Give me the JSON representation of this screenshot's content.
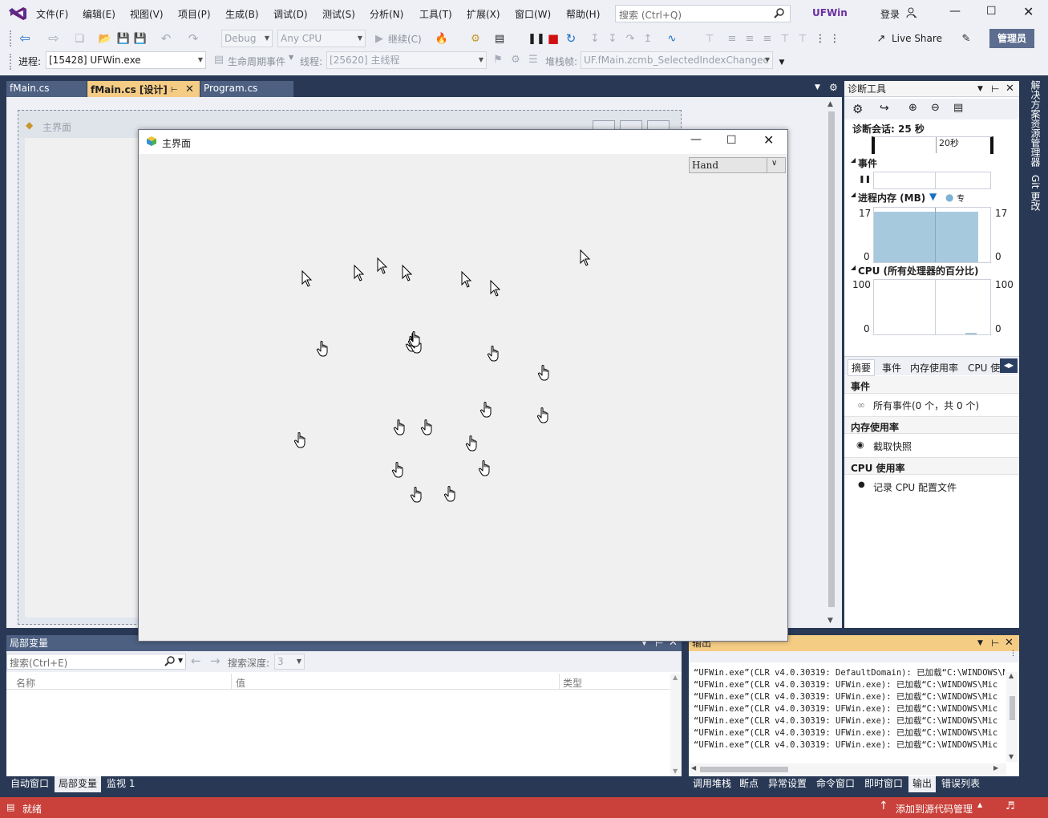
{
  "menu": {
    "items": [
      "文件(F)",
      "编辑(E)",
      "视图(V)",
      "项目(P)",
      "生成(B)",
      "调试(D)",
      "测试(S)",
      "分析(N)",
      "工具(T)",
      "扩展(X)",
      "窗口(W)",
      "帮助(H)"
    ],
    "search_placeholder": "搜索 (Ctrl+Q)",
    "solution_name": "UFWin",
    "login_label": "登录"
  },
  "toolbar": {
    "config": "Debug",
    "platform": "Any CPU",
    "continue_label": "继续(C)",
    "live_share": "Live Share",
    "admin_label": "管理员"
  },
  "debug_bar": {
    "process_label": "进程:",
    "process_value": "[15428] UFWin.exe",
    "lifecycle_label": "生命周期事件",
    "thread_label": "线程:",
    "thread_value": "[25620] 主线程",
    "stack_label": "堆栈帧:",
    "stack_value": "UF.fMain.zcmb_SelectedIndexChangec"
  },
  "doc_tabs": [
    {
      "label": "fMain.cs",
      "state": "inactive"
    },
    {
      "label": "fMain.cs [设计]",
      "state": "active"
    },
    {
      "label": "Program.cs",
      "state": "inactive"
    }
  ],
  "designer_form": {
    "title": "主界面"
  },
  "running_form": {
    "title": "主界面",
    "combo_value": "Hand",
    "arrow_cursor_count": 8,
    "hand_cursor_count": 17
  },
  "side_tabs": [
    "解决方案资源管理器",
    "Git 更改"
  ],
  "diagnostics": {
    "title": "诊断工具",
    "session_label": "诊断会话: 25 秒",
    "timeline_tick": "20秒",
    "events_header": "事件",
    "memory_header": "进程内存 (MB)",
    "memory_legend_extra": "专",
    "memory_max": "17",
    "memory_min": "0",
    "memory_level_pct": 92,
    "cpu_header": "CPU (所有处理器的百分比)",
    "cpu_max": "100",
    "cpu_min": "0",
    "tabs": [
      "摘要",
      "事件",
      "内存使用率",
      "CPU 使"
    ],
    "summary_events_title": "事件",
    "summary_events_text": "所有事件(0 个，共 0 个)",
    "summary_memory_title": "内存使用率",
    "summary_memory_action": "截取快照",
    "summary_cpu_title": "CPU 使用率",
    "summary_cpu_action": "记录 CPU 配置文件"
  },
  "locals": {
    "title": "局部变量",
    "search_placeholder": "搜索(Ctrl+E)",
    "depth_label": "搜索深度:",
    "depth_value": "3",
    "columns": [
      "名称",
      "值",
      "类型"
    ]
  },
  "output": {
    "title": "输出",
    "lines": [
      "“UFWin.exe”(CLR v4.0.30319: DefaultDomain): 已加载“C:\\WINDOWS\\Mic",
      "“UFWin.exe”(CLR v4.0.30319: UFWin.exe): 已加载“C:\\WINDOWS\\Mic",
      "“UFWin.exe”(CLR v4.0.30319: UFWin.exe): 已加载“C:\\WINDOWS\\Mic",
      "“UFWin.exe”(CLR v4.0.30319: UFWin.exe): 已加载“C:\\WINDOWS\\Mic",
      "“UFWin.exe”(CLR v4.0.30319: UFWin.exe): 已加载“C:\\WINDOWS\\Mic",
      "“UFWin.exe”(CLR v4.0.30319: UFWin.exe): 已加载“C:\\WINDOWS\\Mic",
      "“UFWin.exe”(CLR v4.0.30319: UFWin.exe): 已加载“C:\\WINDOWS\\Mic"
    ]
  },
  "bottom_tabs_left": [
    "自动窗口",
    "局部变量",
    "监视 1"
  ],
  "bottom_tabs_right": [
    "调用堆栈",
    "断点",
    "异常设置",
    "命令窗口",
    "即时窗口",
    "输出",
    "错误列表"
  ],
  "status": {
    "ready": "就绪",
    "source_control": "添加到源代码管理"
  },
  "colors": {
    "chrome": "#eef0f5",
    "frame": "#293955",
    "active_tab": "#f5cc84",
    "status_debug": "#c9413a",
    "memory_fill": "#a7c9dd"
  }
}
